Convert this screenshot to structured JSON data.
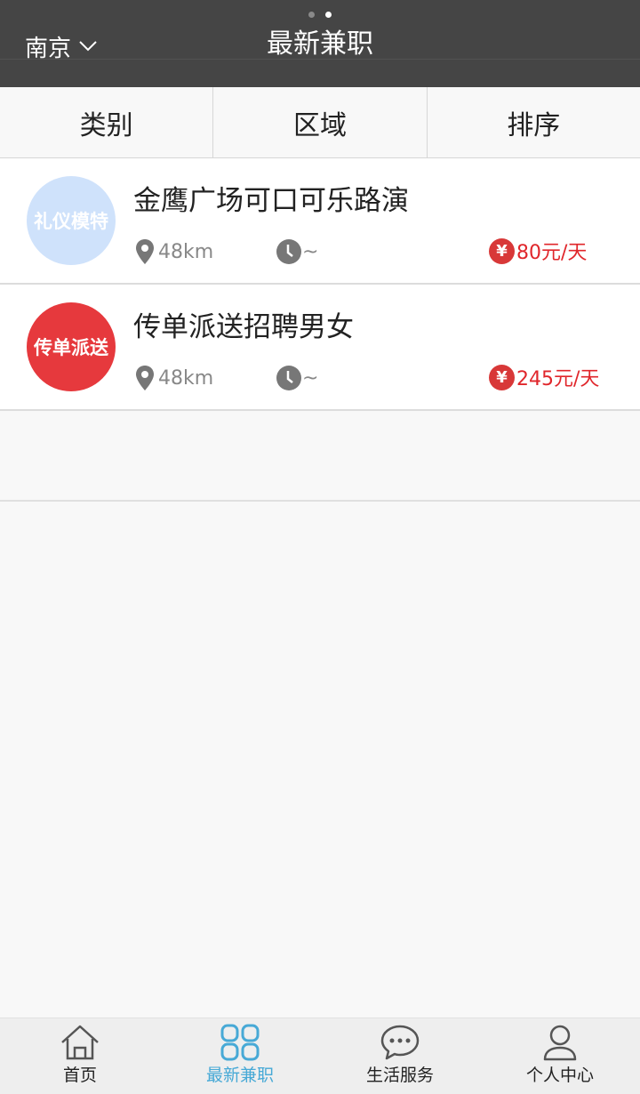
{
  "header": {
    "city": "南京",
    "title": "最新兼职"
  },
  "filters": [
    "类别",
    "区域",
    "排序"
  ],
  "jobs": [
    {
      "avatar_text": "礼仪模特",
      "avatar_color": "#cfe2fb",
      "title": "金鹰广场可口可乐路演",
      "distance": "48km",
      "time": "~",
      "currency": "¥",
      "salary": "80元/天"
    },
    {
      "avatar_text": "传单派送",
      "avatar_color": "#e6393d",
      "title": "传单派送招聘男女",
      "distance": "48km",
      "time": "~",
      "currency": "¥",
      "salary": "245元/天"
    }
  ],
  "tabbar": {
    "items": [
      {
        "label": "首页",
        "icon": "home-icon"
      },
      {
        "label": "最新兼职",
        "icon": "grid-icon"
      },
      {
        "label": "生活服务",
        "icon": "chat-icon"
      },
      {
        "label": "个人中心",
        "icon": "user-icon"
      }
    ],
    "active_color": "#47a9d6"
  }
}
